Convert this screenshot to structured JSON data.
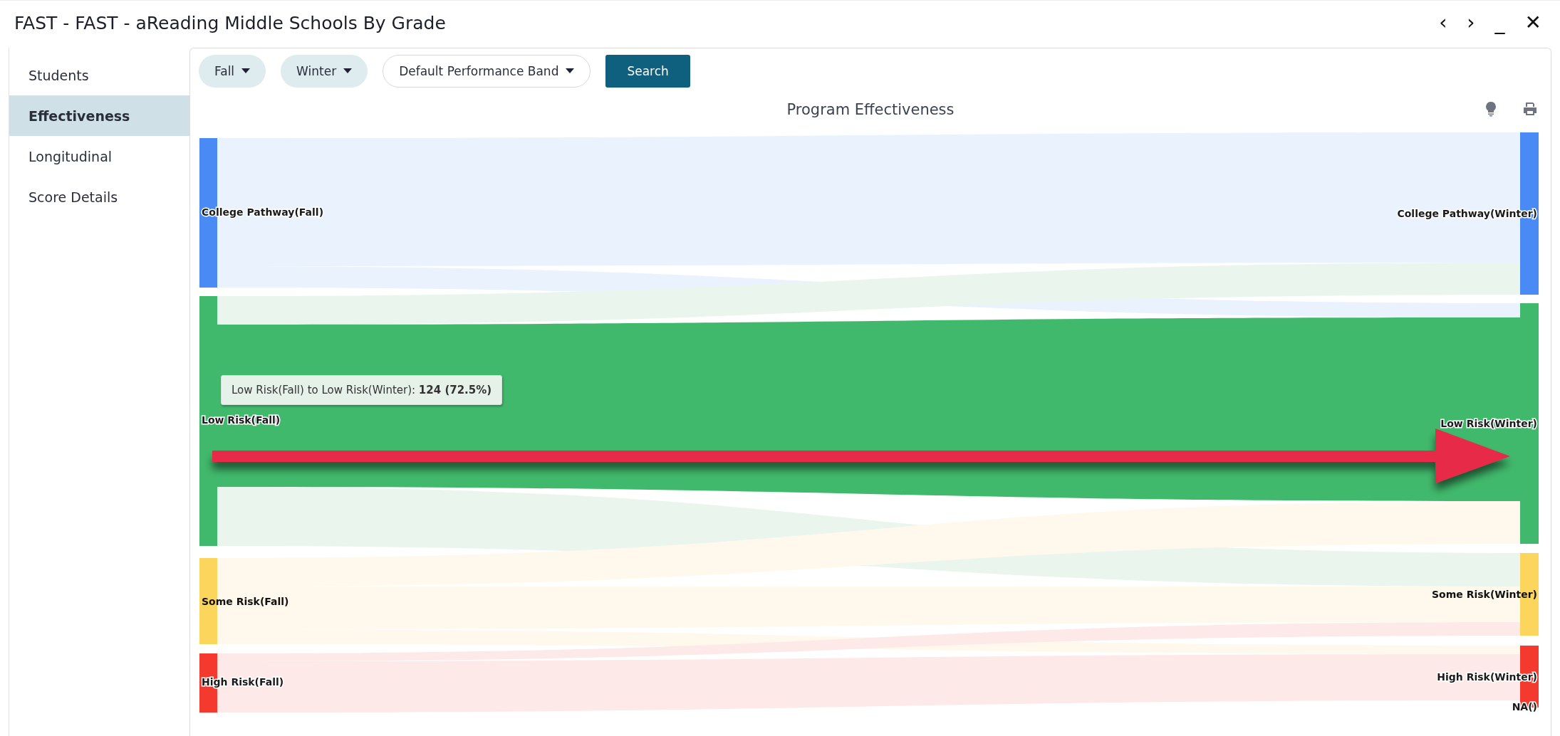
{
  "window": {
    "title": "FAST - FAST - aReading Middle Schools By Grade",
    "controls": [
      "‹",
      "›",
      "_",
      "✕"
    ]
  },
  "sidebar": {
    "items": [
      {
        "label": "Students",
        "selected": false
      },
      {
        "label": "Effectiveness",
        "selected": true
      },
      {
        "label": "Longitudinal",
        "selected": false
      },
      {
        "label": "Score Details",
        "selected": false
      }
    ]
  },
  "filters": [
    {
      "kind": "pill",
      "label": "Fall"
    },
    {
      "kind": "pill",
      "label": "Winter"
    },
    {
      "kind": "outline",
      "label": "Default Performance Band"
    }
  ],
  "search_button": {
    "label": "Search"
  },
  "chart": {
    "title": "Program Effectiveness",
    "left_nodes": [
      {
        "label": "College Pathway(Fall)",
        "color": "#4a8af4",
        "kind": "outlined"
      },
      {
        "label": "Low Risk(Fall)",
        "color": "#41b96c",
        "kind": "outlined"
      },
      {
        "label": "Some Risk(Fall)",
        "color": "#fcd55c",
        "kind": "plain"
      },
      {
        "label": "High Risk(Fall)",
        "color": "#f43a2e",
        "kind": "outlined"
      }
    ],
    "right_nodes": [
      {
        "label": "College Pathway(Winter)",
        "color": "#4a8af4",
        "kind": "outlined"
      },
      {
        "label": "Low Risk(Winter)",
        "color": "#41b96c",
        "kind": "outlined"
      },
      {
        "label": "Some Risk(Winter)",
        "color": "#fcd55c",
        "kind": "plain"
      },
      {
        "label": "High Risk(Winter)",
        "color": "#f43a2e",
        "kind": "outlined"
      },
      {
        "label": "NA()",
        "kind": "outlined"
      }
    ],
    "tooltip": "Low Risk(Fall) to Low Risk(Winter): **124 (72.5%)**"
  }
}
